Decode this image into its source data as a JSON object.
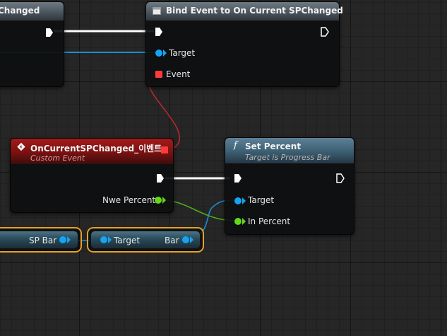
{
  "nodes": {
    "left_partial": {
      "title": "Changed"
    },
    "bind_event": {
      "title": "Bind Event to On Current SPChanged",
      "pins": {
        "target": "Target",
        "event": "Event"
      }
    },
    "custom_event": {
      "title": "OnCurrentSPChanged_이벤트",
      "subtitle": "Custom Event",
      "pins": {
        "output": "Nwe Percent"
      }
    },
    "set_percent": {
      "title": "Set Percent",
      "subtitle": "Target is Progress Bar",
      "func_symbol": "f",
      "pins": {
        "target": "Target",
        "in_percent": "In Percent"
      }
    },
    "sp_bar_var": {
      "label": "SP Bar"
    },
    "bar_getter": {
      "input": "Target",
      "output": "Bar"
    }
  },
  "colors": {
    "exec_wire": "#ffffff",
    "object_pin": "#16a3f2",
    "float_pin": "#62d81a",
    "delegate_pin": "#ff3b3b",
    "variable_highlight": "#e8a126"
  },
  "icons": [
    "function-node-icon",
    "custom-event-icon",
    "delegate-icon",
    "function-f-icon",
    "exec-pin-icon"
  ]
}
